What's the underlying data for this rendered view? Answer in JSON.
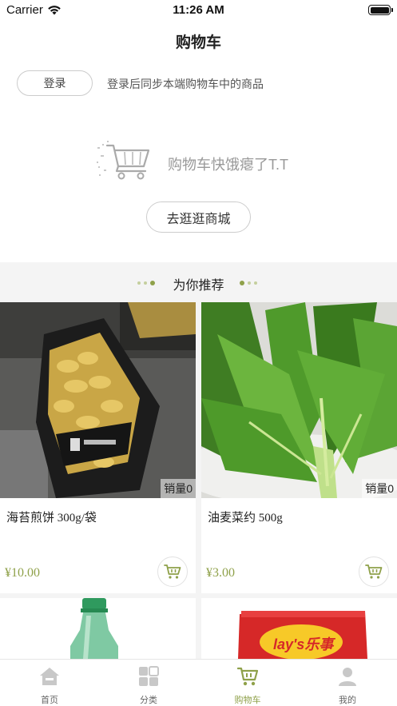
{
  "status_bar": {
    "carrier": "Carrier",
    "time": "11:26 AM"
  },
  "nav": {
    "title": "购物车"
  },
  "login": {
    "button_label": "登录",
    "tip": "登录后同步本端购物车中的商品"
  },
  "empty_cart": {
    "message": "购物车快饿瘪了T.T",
    "go_shopping_label": "去逛逛商城"
  },
  "recommend": {
    "title": "为你推荐"
  },
  "products": [
    {
      "name": "海苔煎饼 300g/袋",
      "price": "¥10.00",
      "sales": "销量0",
      "image": "seaweed-crackers-bag"
    },
    {
      "name": "油麦菜约 500g",
      "price": "¥3.00",
      "sales": "销量0",
      "image": "lettuce-leaves"
    },
    {
      "name": "",
      "price": "",
      "sales": "",
      "image": "green-soda-bottle"
    },
    {
      "name": "",
      "price": "",
      "sales": "",
      "image": "lays-chips-bag"
    }
  ],
  "logo_text": {
    "lays": "lay's乐事"
  },
  "tabs": [
    {
      "label": "首页",
      "icon": "home-icon",
      "active": false
    },
    {
      "label": "分类",
      "icon": "category-grid-icon",
      "active": false
    },
    {
      "label": "购物车",
      "icon": "shopping-cart-icon",
      "active": true
    },
    {
      "label": "我的",
      "icon": "user-icon",
      "active": false
    }
  ],
  "colors": {
    "accent": "#8fa14a",
    "inactive": "#c8c8c8",
    "band": "#f4f4f4"
  }
}
